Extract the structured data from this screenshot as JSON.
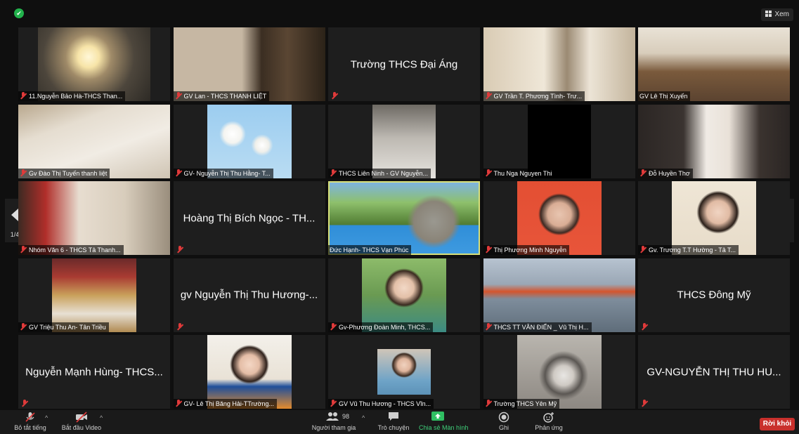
{
  "top": {
    "view_label": "Xem"
  },
  "colors": {
    "active_speaker_border": "#d8e07a",
    "mute_icon": "#e03a3a",
    "leave_button": "#c9302c",
    "security": "#22b24c"
  },
  "nav": {
    "page_left": "1/4",
    "page_right": "1/4"
  },
  "tiles": [
    {
      "label": "11.Nguyễn Bảo Hà-THCS Than..."
    },
    {
      "label": "GV Lan - THCS THANH LIỆT"
    },
    {
      "center": "Trường THCS Đại Áng"
    },
    {
      "label": "GV Trần T. Phương Tình- Trư..."
    },
    {
      "label": "GV Lê Thị Xuyến"
    },
    {
      "label": "Gv Đào Thị Tuyến thanh liệt"
    },
    {
      "label": "GV- Nguyễn Thị Thu Hằng- T..."
    },
    {
      "label": "THCS Liên Ninh - GV Nguyễn..."
    },
    {
      "label": "Thu Nga Nguyen Thi"
    },
    {
      "label": "Đỗ Huyền Thơ"
    },
    {
      "label": "Nhóm Văn 6 - THCS Tả Thanh..."
    },
    {
      "center": "Hoàng Thị Bích Ngọc - TH..."
    },
    {
      "label": "Đức Hạnh- THCS Vạn Phúc"
    },
    {
      "label": "Thị Phương Minh Nguyễn"
    },
    {
      "label": "Gv. Trương T.T Hường - Tả T..."
    },
    {
      "label": "GV Triệu Thu An- Tân Triều"
    },
    {
      "center": "gv Nguyễn Thị Thu Hương-..."
    },
    {
      "label": "Gv-Phương Đoàn Minh, THCS..."
    },
    {
      "label": "THCS TT VĂN ĐIỂN _ Vũ Thị H..."
    },
    {
      "center": "THCS Đông Mỹ"
    },
    {
      "center": "Nguyễn Mạnh Hùng- THCS..."
    },
    {
      "label": "GV- Lê Thị Băng Hải-TTrường..."
    },
    {
      "label": "GV Vũ Thu Hương - THCS Vĩn..."
    },
    {
      "label": "Trường THCS Yên Mỹ"
    },
    {
      "center": "GV-NGUYỄN THỊ THU HU..."
    }
  ],
  "toolbar": {
    "mute": "Bỏ tắt tiếng",
    "video": "Bắt đầu Video",
    "participants": "Người tham gia",
    "participants_count": "98",
    "chat": "Trò chuyện",
    "share": "Chia sẻ Màn hình",
    "record": "Ghi",
    "reactions": "Phản ứng",
    "leave": "Rời khỏi"
  }
}
